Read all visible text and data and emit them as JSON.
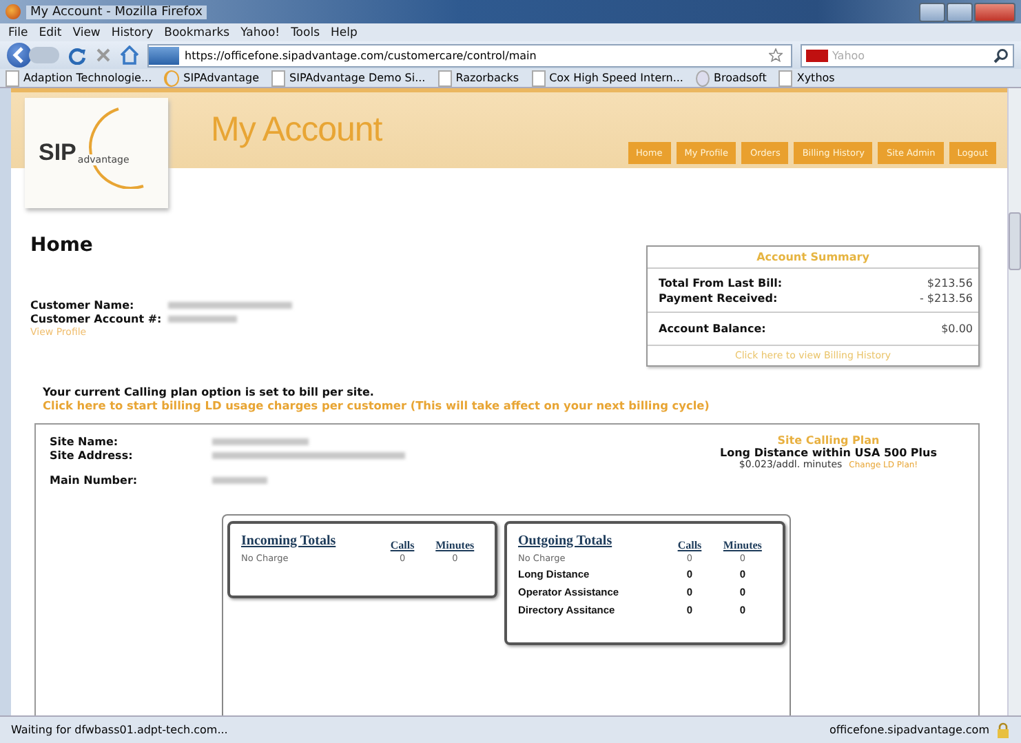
{
  "window": {
    "title": "My Account - Mozilla Firefox"
  },
  "menu_bar": [
    "File",
    "Edit",
    "View",
    "History",
    "Bookmarks",
    "Yahoo!",
    "Tools",
    "Help"
  ],
  "nav_bar": {
    "url": "https://officefone.sipadvantage.com/customercare/control/main",
    "search_placeholder": "Yahoo"
  },
  "bookmarks": [
    {
      "label": "Adaption Technologie...",
      "kind": "page"
    },
    {
      "label": "SIPAdvantage",
      "kind": "site"
    },
    {
      "label": "SIPAdvantage Demo Si...",
      "kind": "page"
    },
    {
      "label": "Razorbacks",
      "kind": "page"
    },
    {
      "label": "Cox High Speed Intern...",
      "kind": "page"
    },
    {
      "label": "Broadsoft",
      "kind": "globe"
    },
    {
      "label": "Xythos",
      "kind": "page"
    }
  ],
  "page": {
    "logo": {
      "main": "SIP",
      "sub": "advantage"
    },
    "title": "My Account",
    "nav_buttons": [
      "Home",
      "My Profile",
      "Orders",
      "Billing History",
      "Site Admin",
      "Logout"
    ],
    "heading": "Home",
    "customer_labels": [
      "Customer Name:",
      "Customer Account #:"
    ],
    "view_profile_link": "View Profile",
    "summary": {
      "title": "Account Summary",
      "rows": [
        {
          "label": "Total From Last Bill:",
          "value": "$213.56"
        },
        {
          "label": "Payment Received:",
          "value": "- $213.56"
        }
      ],
      "balance": {
        "label": "Account Balance:",
        "value": "$0.00"
      },
      "link": "Click here to view Billing History"
    },
    "plan_notice": {
      "text": "Your current Calling plan option is set to bill per site.",
      "link": "Click here to start billing LD usage charges per customer (This will take affect on your next billing cycle)"
    },
    "site": {
      "labels": [
        "Site Name:",
        "Site Address:",
        "Main Number:"
      ],
      "plan_title": "Site Calling Plan",
      "plan_name": "Long Distance within USA 500 Plus",
      "rate": "$0.023/addl. minutes",
      "change_link": "Change LD Plan!"
    },
    "incoming": {
      "title": "Incoming Totals",
      "columns": [
        "Calls",
        "Minutes"
      ],
      "rows": [
        {
          "label": "No Charge",
          "calls": "0",
          "minutes": "0",
          "kind": "plain"
        }
      ]
    },
    "outgoing": {
      "title": "Outgoing Totals",
      "columns": [
        "Calls",
        "Minutes"
      ],
      "rows": [
        {
          "label": "No Charge",
          "calls": "0",
          "minutes": "0",
          "kind": "plain"
        },
        {
          "label": "Long Distance",
          "calls": "0",
          "minutes": "0",
          "kind": "bold"
        },
        {
          "label": "Operator Assistance",
          "calls": "0",
          "minutes": "0",
          "kind": "bold"
        },
        {
          "label": "Directory Assitance",
          "calls": "0",
          "minutes": "0",
          "kind": "bold"
        }
      ]
    }
  },
  "status_bar": {
    "left": "Waiting for dfwbass01.adpt-tech.com...",
    "right": "officefone.sipadvantage.com"
  }
}
